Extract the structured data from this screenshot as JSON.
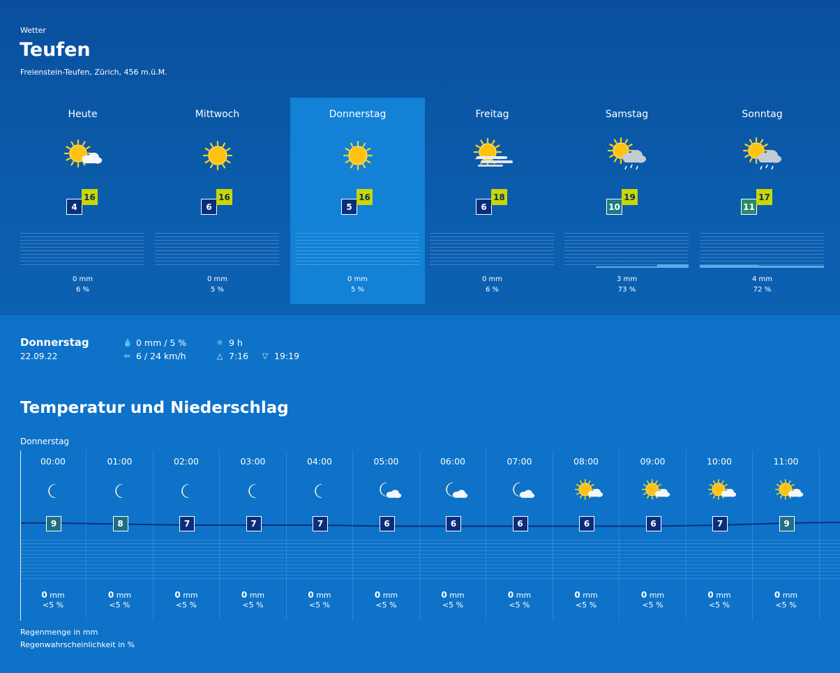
{
  "header": {
    "label": "Wetter",
    "city": "Teufen",
    "subline": "Freienstein-Teufen, Zürich, 456 m.ü.M."
  },
  "days": [
    {
      "name": "Heute",
      "icon": "sun-cloud-icon",
      "min": "4",
      "max": "16",
      "mm": "0 mm",
      "pct": "6 %",
      "rain_fraction": 0
    },
    {
      "name": "Mittwoch",
      "icon": "sun-icon",
      "min": "6",
      "max": "16",
      "mm": "0 mm",
      "pct": "5 %",
      "rain_fraction": 0
    },
    {
      "name": "Donnerstag",
      "icon": "sun-icon",
      "min": "5",
      "max": "16",
      "mm": "0 mm",
      "pct": "5 %",
      "rain_fraction": 0
    },
    {
      "name": "Freitag",
      "icon": "sun-fog-icon",
      "min": "6",
      "max": "18",
      "mm": "0 mm",
      "pct": "6 %",
      "rain_fraction": 0
    },
    {
      "name": "Samstag",
      "icon": "sun-rain-cloud-icon",
      "min": "10",
      "max": "19",
      "mm": "3 mm",
      "pct": "73 %",
      "rain_fraction": 0.4
    },
    {
      "name": "Sonntag",
      "icon": "sun-rain-cloud-icon",
      "min": "11",
      "max": "17",
      "mm": "4 mm",
      "pct": "72 %",
      "rain_fraction": 0.5
    }
  ],
  "selected": {
    "name": "Donnerstag",
    "date": "22.09.22",
    "precip": "0 mm / 5 %",
    "wind": "6 / 24 km/h",
    "sunshine": "9 h",
    "sunrise": "7:16",
    "sunset": "19:19"
  },
  "section_title": "Temperatur und Niederschlag",
  "hourly_day": "Donnerstag",
  "hours": [
    {
      "time": "00:00",
      "icon": "moon-icon",
      "temp": 9,
      "mm": "0",
      "unit": "mm",
      "pct": "<5 %"
    },
    {
      "time": "01:00",
      "icon": "moon-icon",
      "temp": 8,
      "mm": "0",
      "unit": "mm",
      "pct": "<5 %"
    },
    {
      "time": "02:00",
      "icon": "moon-icon",
      "temp": 7,
      "mm": "0",
      "unit": "mm",
      "pct": "<5 %"
    },
    {
      "time": "03:00",
      "icon": "moon-icon",
      "temp": 7,
      "mm": "0",
      "unit": "mm",
      "pct": "<5 %"
    },
    {
      "time": "04:00",
      "icon": "moon-icon",
      "temp": 7,
      "mm": "0",
      "unit": "mm",
      "pct": "<5 %"
    },
    {
      "time": "05:00",
      "icon": "moon-cloud-icon",
      "temp": 6,
      "mm": "0",
      "unit": "mm",
      "pct": "<5 %"
    },
    {
      "time": "06:00",
      "icon": "moon-cloud-icon",
      "temp": 6,
      "mm": "0",
      "unit": "mm",
      "pct": "<5 %"
    },
    {
      "time": "07:00",
      "icon": "moon-cloud-icon",
      "temp": 6,
      "mm": "0",
      "unit": "mm",
      "pct": "<5 %"
    },
    {
      "time": "08:00",
      "icon": "sun-cloud-icon",
      "temp": 6,
      "mm": "0",
      "unit": "mm",
      "pct": "<5 %"
    },
    {
      "time": "09:00",
      "icon": "sun-cloud-icon",
      "temp": 6,
      "mm": "0",
      "unit": "mm",
      "pct": "<5 %"
    },
    {
      "time": "10:00",
      "icon": "sun-cloud-icon",
      "temp": 7,
      "mm": "0",
      "unit": "mm",
      "pct": "<5 %"
    },
    {
      "time": "11:00",
      "icon": "sun-cloud-icon",
      "temp": 9,
      "mm": "0",
      "unit": "mm",
      "pct": "<5 %"
    }
  ],
  "legend": {
    "rain_amount": "Regenmenge in mm",
    "rain_probability": "Regenwahrscheinlichkeit in %"
  },
  "colors": {
    "background": "#0d72c8",
    "selected_day": "#1281d6",
    "max_temp": "#c8d60a",
    "min_temp": "#0b2e7c"
  }
}
